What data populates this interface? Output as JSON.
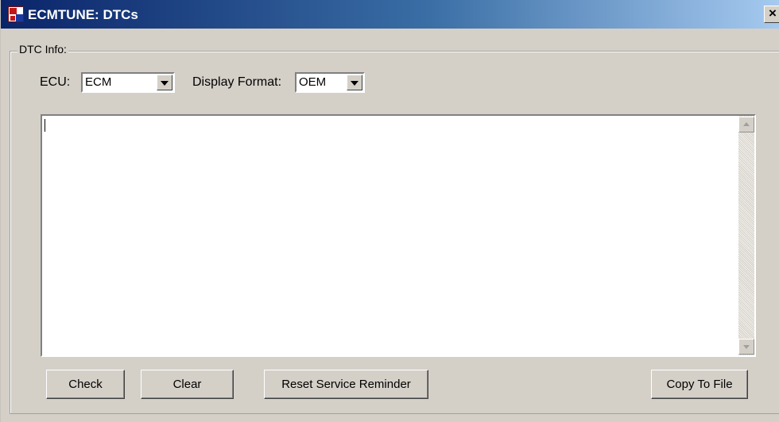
{
  "window": {
    "title": "ECMTUNE: DTCs",
    "close_label": "×"
  },
  "group": {
    "label": "DTC Info:"
  },
  "ecu": {
    "label": "ECU:",
    "value": "ECM"
  },
  "display_format": {
    "label": "Display Format:",
    "value": "OEM"
  },
  "output": {
    "text": ""
  },
  "buttons": {
    "check": "Check",
    "clear": "Clear",
    "reset": "Reset Service Reminder",
    "copy": "Copy To File"
  },
  "icons": {
    "app": "ecmtune-app-icon",
    "close": "close-icon",
    "dropdown": "chevron-down-icon",
    "scroll_up": "scroll-up-arrow-icon",
    "scroll_down": "scroll-down-arrow-icon"
  },
  "colors": {
    "titlebar_start": "#0a246a",
    "titlebar_end": "#a6caf0",
    "window_bg": "#d4d0c8"
  }
}
